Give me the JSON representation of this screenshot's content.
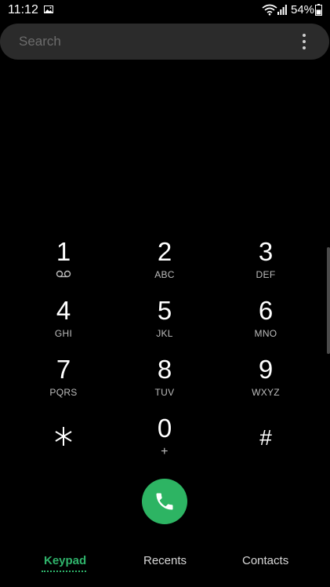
{
  "status_bar": {
    "time": "11:12",
    "battery": "54%"
  },
  "search": {
    "placeholder": "Search",
    "value": ""
  },
  "keypad": [
    {
      "digit": "1",
      "letters": ""
    },
    {
      "digit": "2",
      "letters": "ABC"
    },
    {
      "digit": "3",
      "letters": "DEF"
    },
    {
      "digit": "4",
      "letters": "GHI"
    },
    {
      "digit": "5",
      "letters": "JKL"
    },
    {
      "digit": "6",
      "letters": "MNO"
    },
    {
      "digit": "7",
      "letters": "PQRS"
    },
    {
      "digit": "8",
      "letters": "TUV"
    },
    {
      "digit": "9",
      "letters": "WXYZ"
    },
    {
      "digit": "⁎",
      "letters": ""
    },
    {
      "digit": "0",
      "letters": "+"
    },
    {
      "digit": "#",
      "letters": ""
    }
  ],
  "tabs": {
    "keypad": "Keypad",
    "recents": "Recents",
    "contacts": "Contacts"
  },
  "icons": {
    "gallery": "image-icon",
    "wifi": "wifi-icon",
    "signal": "signal-icon",
    "battery": "battery-icon",
    "more": "more-vertical-icon",
    "voicemail": "voicemail-icon",
    "call": "phone-icon"
  },
  "colors": {
    "accent": "#2fb36b",
    "call_button": "#2db463",
    "background": "#000000",
    "search_background": "#2b2b2b"
  }
}
